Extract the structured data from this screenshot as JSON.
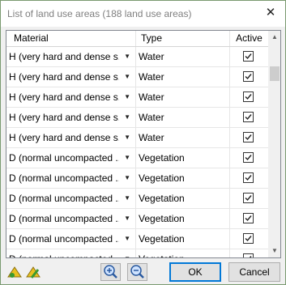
{
  "window": {
    "title": "List of land use areas (188 land use areas)",
    "close_glyph": "✕"
  },
  "table": {
    "columns": {
      "material": "Material",
      "type": "Type",
      "active": "Active"
    },
    "rows": [
      {
        "material": "H (very hard and dense s...",
        "type": "Water",
        "active": true
      },
      {
        "material": "H (very hard and dense s...",
        "type": "Water",
        "active": true
      },
      {
        "material": "H (very hard and dense s...",
        "type": "Water",
        "active": true
      },
      {
        "material": "H (very hard and dense s...",
        "type": "Water",
        "active": true
      },
      {
        "material": "H (very hard and dense s...",
        "type": "Water",
        "active": true
      },
      {
        "material": "D (normal uncompacted ...",
        "type": "Vegetation",
        "active": true
      },
      {
        "material": "D (normal uncompacted ...",
        "type": "Vegetation",
        "active": true
      },
      {
        "material": "D (normal uncompacted ...",
        "type": "Vegetation",
        "active": true
      },
      {
        "material": "D (normal uncompacted ...",
        "type": "Vegetation",
        "active": true
      },
      {
        "material": "D (normal uncompacted ...",
        "type": "Vegetation",
        "active": true
      },
      {
        "material": "D (normal uncompacted ...",
        "type": "Vegetation",
        "active": true
      }
    ]
  },
  "buttons": {
    "ok": "OK",
    "cancel": "Cancel"
  },
  "icons": {
    "tool1": "land-use-tool-icon",
    "tool2": "land-use-edit-icon",
    "zoom_in": "zoom-in-icon",
    "zoom_out": "zoom-out-icon"
  },
  "colors": {
    "accent": "#0078d7",
    "background": "#eafbe6",
    "tool_yellow": "#e8c020",
    "tool_green": "#3a9a30"
  }
}
